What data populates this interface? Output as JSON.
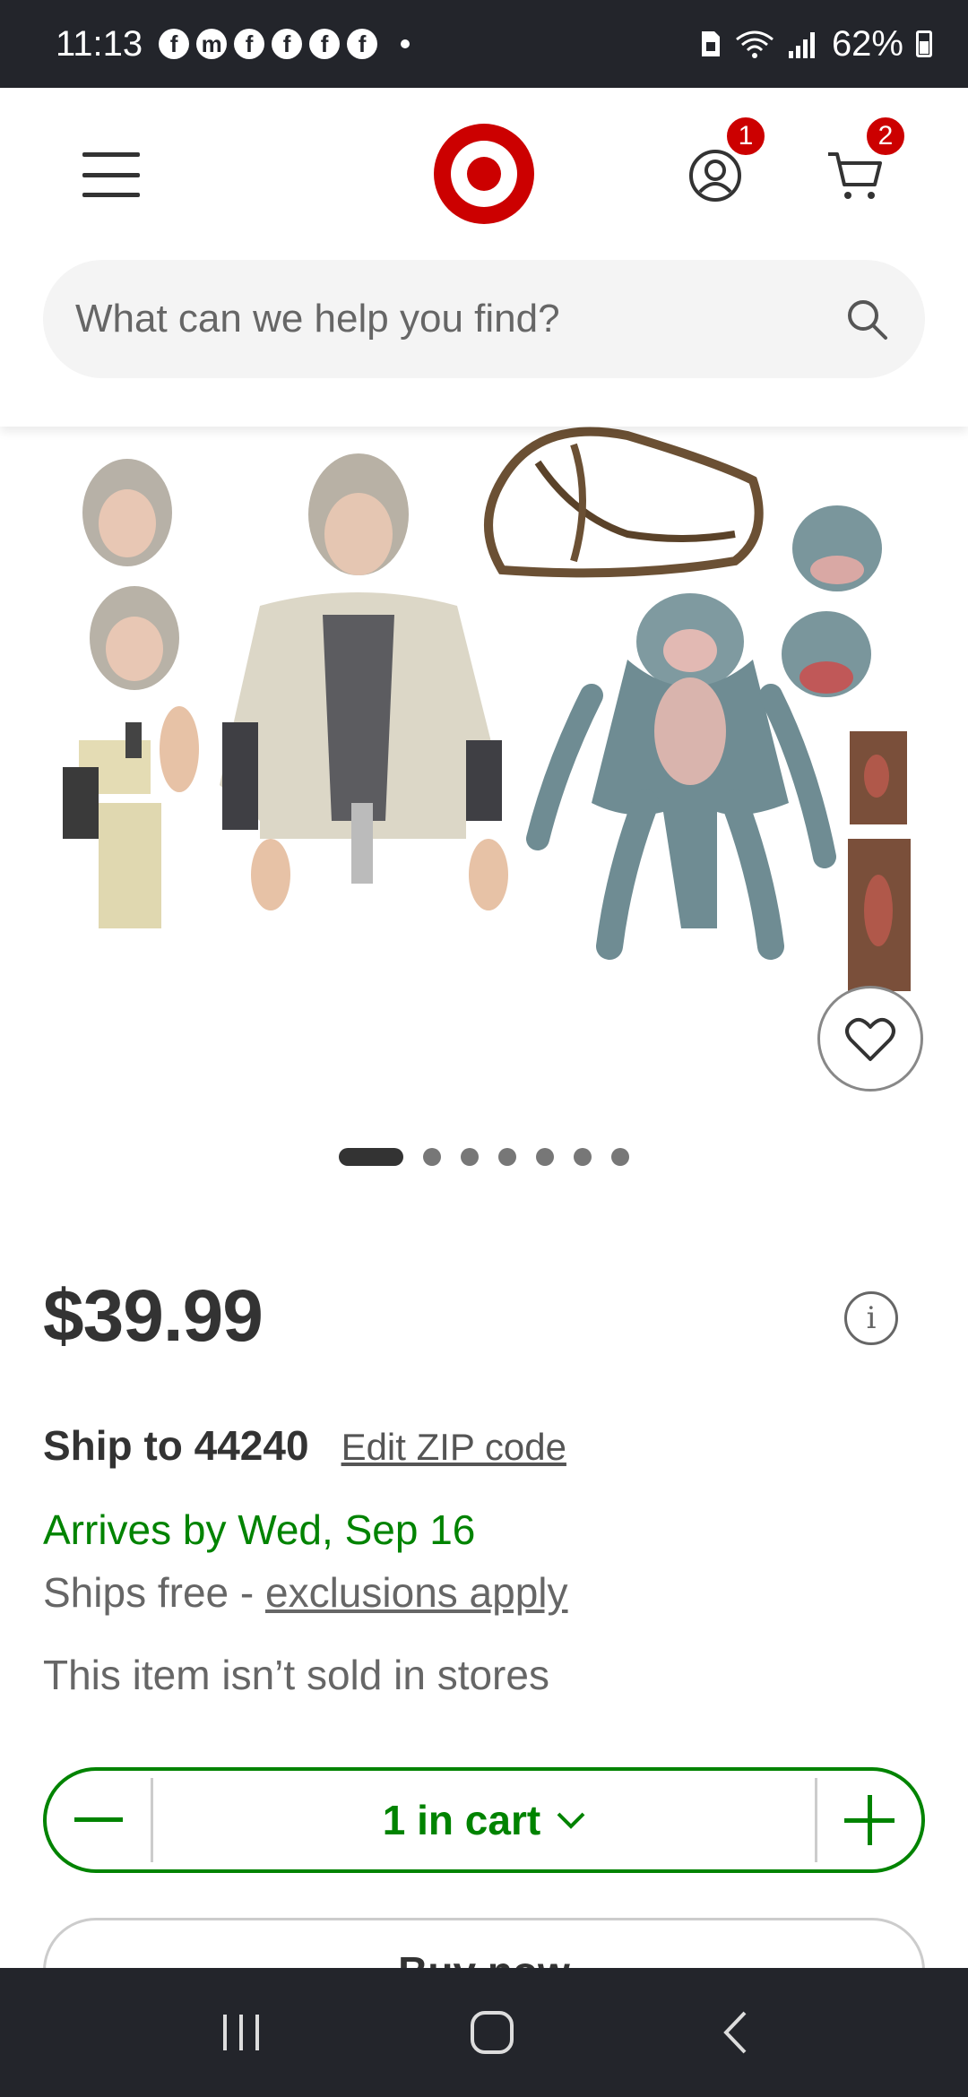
{
  "status_bar": {
    "time": "11:13",
    "notification_icons": [
      "facebook-icon",
      "messenger-icon",
      "facebook-icon",
      "facebook-icon",
      "facebook-icon",
      "facebook-icon"
    ],
    "battery": "62%"
  },
  "header": {
    "account_badge": "1",
    "cart_badge": "2",
    "search_placeholder": "What can we help you find?"
  },
  "gallery": {
    "image_count": 7,
    "active_index": 0
  },
  "product": {
    "price": "$39.99",
    "ship_to": "Ship to 44240",
    "edit_zip": "Edit ZIP code",
    "arrives": "Arrives by Wed, Sep 16",
    "ships_free_prefix": "Ships free - ",
    "ships_free_link": "exclusions apply",
    "store_note": "This item isn’t sold in stores"
  },
  "cart": {
    "quantity_label": "1 in cart"
  },
  "buy_now_label": "Buy now",
  "colors": {
    "brand_red": "#cc0000",
    "accent_green": "#008300",
    "text_dark": "#333333"
  }
}
